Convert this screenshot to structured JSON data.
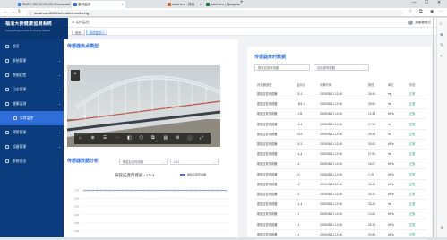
{
  "browser": {
    "tabs": [
      {
        "label": "SDZS /SB:DESENISHS/completion/hy...",
        "fav_color": "#3b7bd8",
        "active": false
      },
      {
        "label": "高校监测",
        "fav_color": "#2f6ed8",
        "active": true
      },
      {
        "label": "dataHero - 搜索",
        "fav_color": "#d45b2b",
        "active": false
      },
      {
        "label": "dataHero | Django-suyh-admin",
        "fav_color": "#1b6e3a",
        "active": false
      }
    ],
    "url": "localhost:8080/#/health/monitoring",
    "new_tab": "+",
    "win_min": "—",
    "win_max": "☐",
    "win_close": "✕",
    "back": "←",
    "forward": "→",
    "reload": "↻"
  },
  "sidebar": {
    "title": "福清大桥健康监测系统",
    "subtitle": "Fuqing Bridge Health Monitoring System",
    "items": [
      {
        "label": "首页",
        "has_children": false,
        "sub": false,
        "active": false
      },
      {
        "label": "系统管理",
        "has_children": true,
        "sub": false,
        "active": false
      },
      {
        "label": "数据配置",
        "has_children": true,
        "sub": false,
        "active": false
      },
      {
        "label": "日志管理",
        "has_children": true,
        "sub": false,
        "active": false
      },
      {
        "label": "健康监测",
        "has_children": true,
        "sub": false,
        "active": false
      },
      {
        "label": "实时监控",
        "has_children": false,
        "sub": true,
        "active": true
      },
      {
        "label": "预警管理",
        "has_children": true,
        "sub": false,
        "active": false
      },
      {
        "label": "设备管理",
        "has_children": true,
        "sub": false,
        "active": false
      },
      {
        "label": "系统日志",
        "has_children": false,
        "sub": false,
        "active": false
      }
    ]
  },
  "header": {
    "breadcrumb": "☰  实时监控",
    "user": "超级管理员",
    "tags": [
      {
        "label": "首页",
        "active": false
      },
      {
        "label": "实时监控 ×",
        "active": true
      }
    ]
  },
  "left": {
    "model_title": "传感器热点模型",
    "model_compass": "N",
    "model_tools": [
      "⌂",
      "⊕",
      "☰",
      "⋯",
      "◧",
      "⬡",
      "⧉",
      "▤",
      "⚙",
      "ⓘ",
      "⤢"
    ],
    "analysis_title": "传感器数据分析",
    "select_type": "振弦应变传感器",
    "select_sensor": "L5-1",
    "chart_title": "振弦应变传感器 - L5-1",
    "legend": "振弦应变传感器"
  },
  "right": {
    "title": "传感器实时数据",
    "select1": "振弦应变传感器",
    "select2": "请选择传感器",
    "columns": [
      "传感器类型",
      "监测点",
      "采集时间",
      "数值",
      "单位",
      "状态"
    ],
    "rows": [
      [
        "振弦应变传感器",
        "L5-1",
        "2025/08/21 12:48",
        "26.40",
        "℃",
        "正常"
      ],
      [
        "振弦应变传感器",
        "L5/3-1",
        "2025/08/21 12:48",
        "25.60",
        "℃",
        "正常"
      ],
      [
        "振弦应变传感器",
        "L7/8",
        "2025/08/21 12:48",
        "12.33",
        "MPa",
        "正常"
      ],
      [
        "振弦应变传感器",
        "L3-4",
        "2025/08/21 12:48",
        "27.55",
        "℃",
        "正常"
      ],
      [
        "振弦应变传感器",
        "L3-2",
        "2025/08/21 12:48",
        "25.35",
        "℃",
        "正常"
      ],
      [
        "振弦应变传感器",
        "L5-1",
        "2025/08/21 12:48",
        "33.63",
        "MPa",
        "正常"
      ],
      [
        "振弦应变传感器",
        "L4-4",
        "2025/08/21 12:48",
        "27.50",
        "℃",
        "正常"
      ],
      [
        "振弦应变传感器",
        "L4",
        "2025/08/21 12:48",
        "16.07",
        "MPa",
        "正常"
      ],
      [
        "振弦应变传感器",
        "L3",
        "2025/08/21 12:48",
        "1.76",
        "MPa",
        "正常"
      ],
      [
        "振弦应变传感器",
        "L3",
        "2025/08/21 12:48",
        "18.33",
        "MPa",
        "正常"
      ],
      [
        "振弦应变传感器",
        "L2",
        "2025/08/21 12:48",
        "30.31",
        "MPa",
        "正常"
      ],
      [
        "振弦应变传感器",
        "L1-4",
        "2025/08/21 12:48",
        "26.25",
        "℃",
        "正常"
      ],
      [
        "振弦应变传感器",
        "L7",
        "2025/08/21 12:48",
        "13.63",
        "MPa",
        "正常"
      ],
      [
        "振弦应变传感器",
        "L1",
        "2025/08/21 12:48",
        "25.33",
        "MPa",
        "正常"
      ],
      [
        "振弦应变传感器",
        "L1",
        "2025/08/21 12:48",
        "32.85",
        "MPa",
        "正常"
      ]
    ]
  },
  "colors": {
    "sidebar": "#0b3d7e",
    "accent": "#2f6ed8",
    "status_ok": "#22a06b"
  },
  "chart_data": {
    "type": "line",
    "title": "振弦应变传感器 - L5-1",
    "series": [
      {
        "name": "振弦应变传感器",
        "values": [
          170,
          170,
          170,
          170,
          170,
          170,
          170,
          170,
          170,
          170,
          170,
          170,
          170,
          170,
          170,
          170,
          170,
          170,
          170,
          170,
          170,
          170,
          170,
          170,
          170,
          170,
          170,
          170,
          170,
          170,
          170,
          170,
          170,
          170
        ]
      }
    ],
    "yticks": [
      "170",
      "160",
      "150",
      "140",
      "130",
      "120"
    ],
    "ylim": [
      120,
      175
    ]
  }
}
